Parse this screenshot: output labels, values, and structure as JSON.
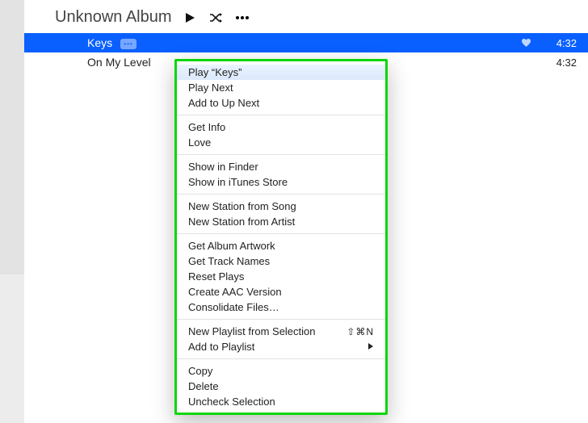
{
  "album": {
    "title": "Unknown Album"
  },
  "tracks": [
    {
      "name": "Keys",
      "duration": "4:32",
      "selected": true,
      "loved": true,
      "badge": "•••"
    },
    {
      "name": "On My Level",
      "duration": "4:32",
      "selected": false,
      "loved": false
    }
  ],
  "context_menu": {
    "groups": [
      [
        {
          "label": "Play “Keys”",
          "highlight": true
        },
        {
          "label": "Play Next"
        },
        {
          "label": "Add to Up Next"
        }
      ],
      [
        {
          "label": "Get Info"
        },
        {
          "label": "Love"
        }
      ],
      [
        {
          "label": "Show in Finder"
        },
        {
          "label": "Show in iTunes Store"
        }
      ],
      [
        {
          "label": "New Station from Song"
        },
        {
          "label": "New Station from Artist"
        }
      ],
      [
        {
          "label": "Get Album Artwork"
        },
        {
          "label": "Get Track Names"
        },
        {
          "label": "Reset Plays"
        },
        {
          "label": "Create AAC Version"
        },
        {
          "label": "Consolidate Files…"
        }
      ],
      [
        {
          "label": "New Playlist from Selection",
          "shortcut": "⇧⌘N"
        },
        {
          "label": "Add to Playlist",
          "submenu": true
        }
      ],
      [
        {
          "label": "Copy"
        },
        {
          "label": "Delete"
        },
        {
          "label": "Uncheck Selection"
        }
      ]
    ]
  }
}
